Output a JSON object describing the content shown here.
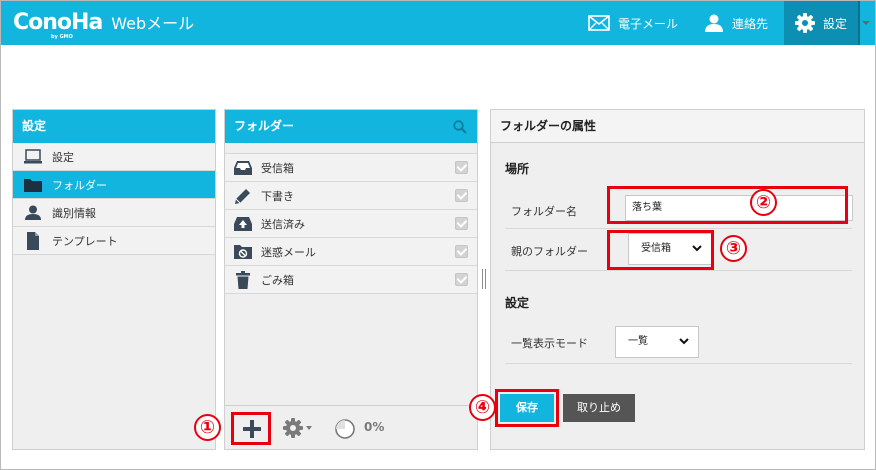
{
  "header": {
    "logo_text": "ConoHa",
    "logo_sub": "by GMO",
    "product": "Webメール",
    "nav": [
      {
        "label": "電子メール",
        "icon": "envelope-icon"
      },
      {
        "label": "連絡先",
        "icon": "person-icon"
      },
      {
        "label": "設定",
        "icon": "gear-icon"
      }
    ],
    "active_color": "#0c8fb3",
    "brand_color": "#12b5dd"
  },
  "settings_panel": {
    "title": "設定",
    "items": [
      {
        "label": "設定",
        "icon": "monitor-icon"
      },
      {
        "label": "フォルダー",
        "icon": "folder-icon",
        "active": true
      },
      {
        "label": "識別情報",
        "icon": "id-card-icon"
      },
      {
        "label": "テンプレート",
        "icon": "document-icon"
      }
    ]
  },
  "folders_panel": {
    "title": "フォルダー",
    "folders": [
      {
        "label": "受信箱",
        "icon": "inbox-icon",
        "subscribed": true
      },
      {
        "label": "下書き",
        "icon": "pencil-icon",
        "subscribed": true
      },
      {
        "label": "送信済み",
        "icon": "sent-icon",
        "subscribed": true
      },
      {
        "label": "迷惑メール",
        "icon": "junk-icon",
        "subscribed": true
      },
      {
        "label": "ごみ箱",
        "icon": "trash-icon",
        "subscribed": true
      }
    ],
    "quota": "0%"
  },
  "properties": {
    "title": "フォルダーの属性",
    "location_title": "場所",
    "folder_name_label": "フォルダー名",
    "folder_name_value": "落ち葉",
    "parent_label": "親のフォルダー",
    "parent_value": "受信箱",
    "settings_title": "設定",
    "view_mode_label": "一覧表示モード",
    "view_mode_value": "一覧",
    "save": "保存",
    "cancel": "取り止め"
  },
  "annotations": [
    "①",
    "②",
    "③",
    "④"
  ]
}
